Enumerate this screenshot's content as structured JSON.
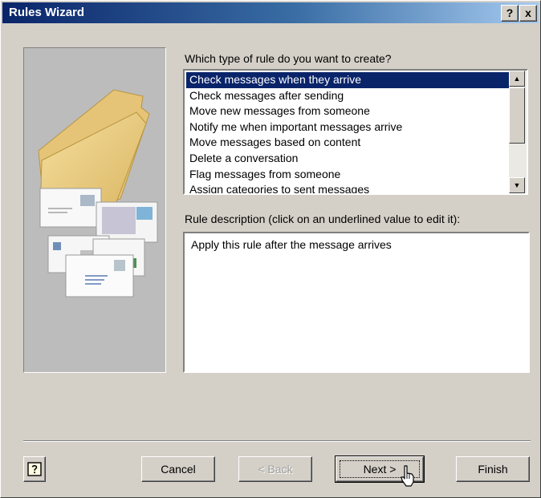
{
  "window": {
    "title": "Rules Wizard",
    "help_button": "?",
    "close_button": "x"
  },
  "rule_type": {
    "label": "Which type of rule do you want to create?",
    "options": [
      "Check messages when they arrive",
      "Check messages after sending",
      "Move new messages from someone",
      "Notify me when important messages arrive",
      "Move messages based on content",
      "Delete a conversation",
      "Flag messages from someone",
      "Assign categories to sent messages"
    ],
    "selected_index": 0
  },
  "description": {
    "label": "Rule description (click on an underlined value to edit it):",
    "text": "Apply this rule after the message arrives"
  },
  "buttons": {
    "cancel": "Cancel",
    "back": "< Back",
    "next": "Next >",
    "finish": "Finish"
  },
  "colors": {
    "selection": "#0a246a",
    "dialog_bg": "#d4d0c8"
  }
}
